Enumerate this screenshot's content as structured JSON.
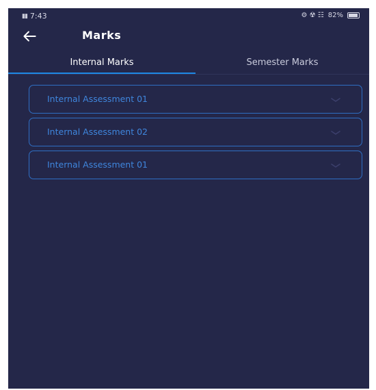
{
  "status_bar": {
    "time": "7:43",
    "battery_percent": "82%",
    "network_indicators": "⚙ ☢ ☷"
  },
  "header": {
    "title": "Marks"
  },
  "tabs": [
    {
      "label": "Internal Marks",
      "active": true
    },
    {
      "label": "Semester Marks",
      "active": false
    }
  ],
  "assessments": [
    {
      "label": "Internal Assessment 01"
    },
    {
      "label": "Internal Assessment 02"
    },
    {
      "label": "Internal Assessment 01"
    }
  ],
  "colors": {
    "background": "#242749",
    "accent": "#1e88e5",
    "accordion_text": "#3f86dd"
  }
}
